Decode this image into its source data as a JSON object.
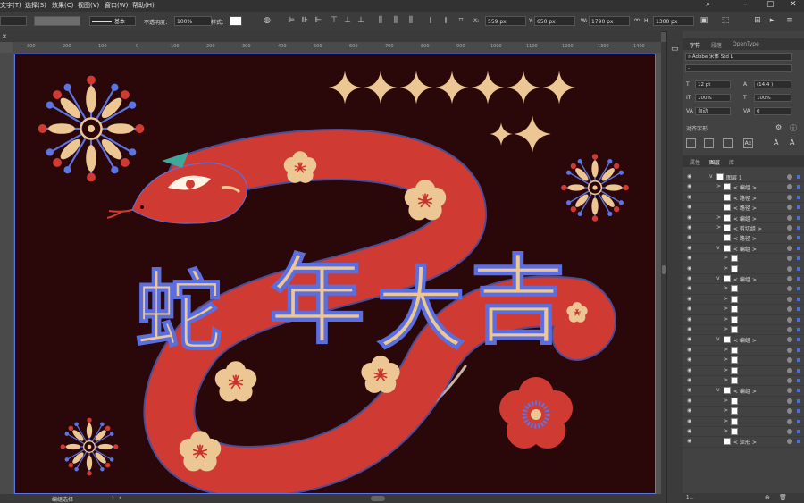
{
  "menu": {
    "items": [
      "文字(T)",
      "选择(S)",
      "效果(C)",
      "视图(V)",
      "窗口(W)",
      "帮助(H)"
    ]
  },
  "control_bar": {
    "stroke_style": "基本",
    "opacity_label": "不透明度：",
    "opacity_value": "100%",
    "style_label": "样式：",
    "x_value": "559 px",
    "y_value": "650 px",
    "w_value": "1790 px",
    "h_value": "1300 px"
  },
  "ruler": {
    "ticks": [
      "300",
      "200",
      "100",
      "0",
      "100",
      "200",
      "300",
      "400",
      "500",
      "600",
      "700",
      "800",
      "900",
      "1000",
      "1100",
      "1200",
      "1300",
      "1400"
    ]
  },
  "artwork": {
    "title_chars": [
      "蛇",
      "年",
      "大",
      "吉"
    ]
  },
  "status": {
    "tool_label": "编组选择"
  },
  "character_panel": {
    "tabs": [
      "字符",
      "段落",
      "OpenType"
    ],
    "font_family": "Adobe 宋体 Std L",
    "font_style": "-",
    "size": "12 pt",
    "leading": "(14.4 )",
    "vscale": "100%",
    "hscale": "100%",
    "kerning": "自动",
    "tracking": "0",
    "align_glyph_label": "对齐字形"
  },
  "layers_panel": {
    "tabs": [
      "属性",
      "图层",
      "库"
    ],
    "rows": [
      {
        "name": "图层 1",
        "indent": 0,
        "arrow": "v"
      },
      {
        "name": "< 编组 >",
        "indent": 1,
        "arrow": ">"
      },
      {
        "name": "< 路径 >",
        "indent": 1,
        "arrow": ""
      },
      {
        "name": "< 路径 >",
        "indent": 1,
        "arrow": ""
      },
      {
        "name": "< 编组 >",
        "indent": 1,
        "arrow": ">"
      },
      {
        "name": "< 剪切组 >",
        "indent": 1,
        "arrow": ">"
      },
      {
        "name": "< 路径 >",
        "indent": 1,
        "arrow": ""
      },
      {
        "name": "< 编组 >",
        "indent": 1,
        "arrow": "v"
      },
      {
        "name": "",
        "indent": 2,
        "arrow": ">"
      },
      {
        "name": "",
        "indent": 2,
        "arrow": ">"
      },
      {
        "name": "< 编组 >",
        "indent": 1,
        "arrow": "v"
      },
      {
        "name": "",
        "indent": 2,
        "arrow": ">"
      },
      {
        "name": "",
        "indent": 2,
        "arrow": ">"
      },
      {
        "name": "",
        "indent": 2,
        "arrow": ">"
      },
      {
        "name": "",
        "indent": 2,
        "arrow": ">"
      },
      {
        "name": "",
        "indent": 2,
        "arrow": ">"
      },
      {
        "name": "< 编组 >",
        "indent": 1,
        "arrow": "v"
      },
      {
        "name": "",
        "indent": 2,
        "arrow": ">"
      },
      {
        "name": "",
        "indent": 2,
        "arrow": ">"
      },
      {
        "name": "",
        "indent": 2,
        "arrow": ">"
      },
      {
        "name": "",
        "indent": 2,
        "arrow": ">"
      },
      {
        "name": "< 编组 >",
        "indent": 1,
        "arrow": "v"
      },
      {
        "name": "",
        "indent": 2,
        "arrow": ">"
      },
      {
        "name": "",
        "indent": 2,
        "arrow": ">"
      },
      {
        "name": "",
        "indent": 2,
        "arrow": ">"
      },
      {
        "name": "",
        "indent": 2,
        "arrow": ">"
      },
      {
        "name": "< 矩形 >",
        "indent": 1,
        "arrow": ""
      }
    ],
    "footer_label": "1..."
  },
  "colors": {
    "artboard_bg": "#2a0708",
    "snake_red": "#cf3b33",
    "cream": "#ecc693",
    "selection_blue": "#4a6fd8"
  }
}
